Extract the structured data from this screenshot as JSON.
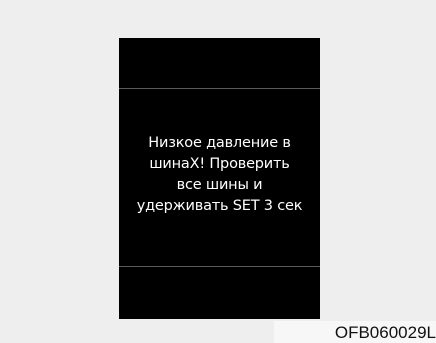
{
  "display": {
    "message_lines": [
      "Низкое давление в",
      "шинаХ! Проверить",
      "все шины и",
      "удерживать SET 3 сек"
    ]
  },
  "figure_code": "OFB060029L"
}
